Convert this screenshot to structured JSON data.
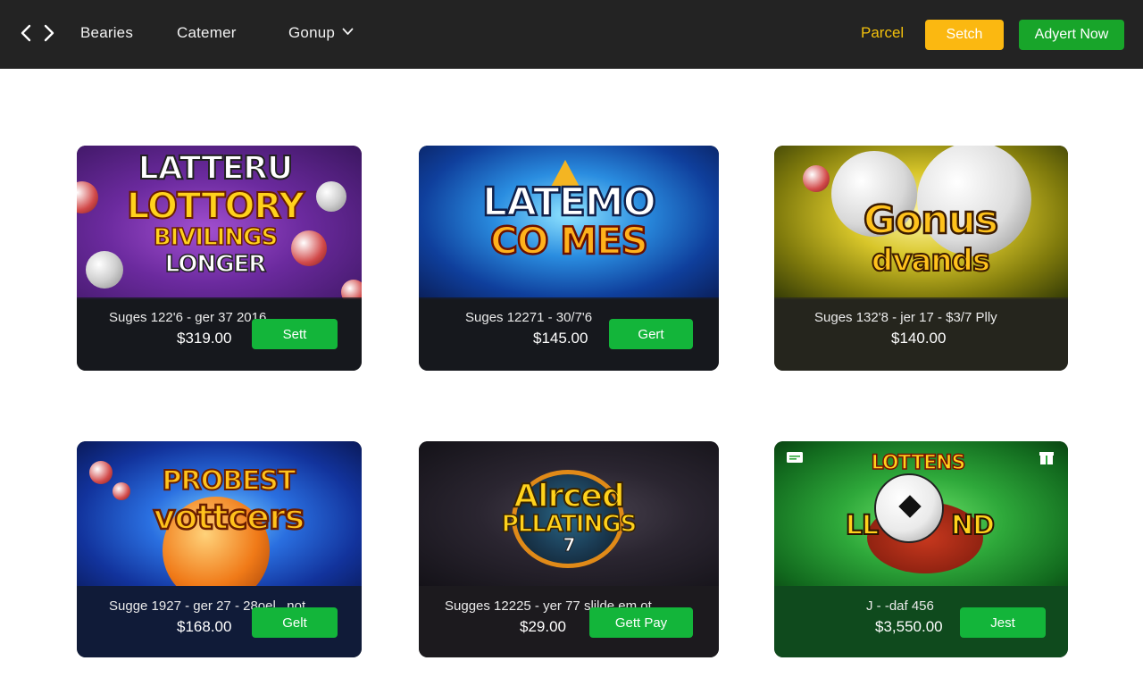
{
  "header": {
    "nav": [
      "Bearies",
      "Catemer",
      "Gonup"
    ],
    "parcel": "Parcel",
    "switch_label": "Setch",
    "advert_label": "Adyert Now"
  },
  "icons": [
    "back-arrow-icon",
    "forward-arrow-icon",
    "chevron-down-icon",
    "ticket-icon",
    "gift-icon"
  ],
  "colors": {
    "topbar": "#232323",
    "accent_yellow": "#fbb811",
    "accent_green": "#18a52a",
    "get_button": "#13b53a"
  },
  "cards": [
    {
      "art_lines": [
        "LATTERU",
        "LOTTORY",
        "BIVILINGS",
        "LONGER"
      ],
      "meta": "Suges 122'6 - ger 37 2016",
      "price": "$319.00",
      "button": "Sett"
    },
    {
      "art_lines": [
        "LATEMO",
        "CO MES"
      ],
      "meta": "Suges 12271 - 30/7'6",
      "price": "$145.00",
      "button": "Gert"
    },
    {
      "art_lines": [
        "Gonus",
        "dvands"
      ],
      "meta": "Suges 132'8 - jer 17 - $3/7 Plly",
      "price": "$140.00",
      "button": ""
    },
    {
      "art_lines": [
        "PROBEST",
        "vottcers"
      ],
      "meta": "Sugge 1927 - ger 27 - 28oel. .not",
      "price": "$168.00",
      "button": "Gelt"
    },
    {
      "art_lines": [
        "Alrced",
        "PLLATINGS",
        "7"
      ],
      "meta": "Sugges 12225 - yer 77 slilde em ot",
      "price": "$29.00",
      "button": "Gett Pay"
    },
    {
      "art_lines": [
        "LOTTENS",
        "LL",
        "ND"
      ],
      "meta": "J - -daf 456",
      "price": "$3,550.00",
      "button": "Jest"
    }
  ]
}
